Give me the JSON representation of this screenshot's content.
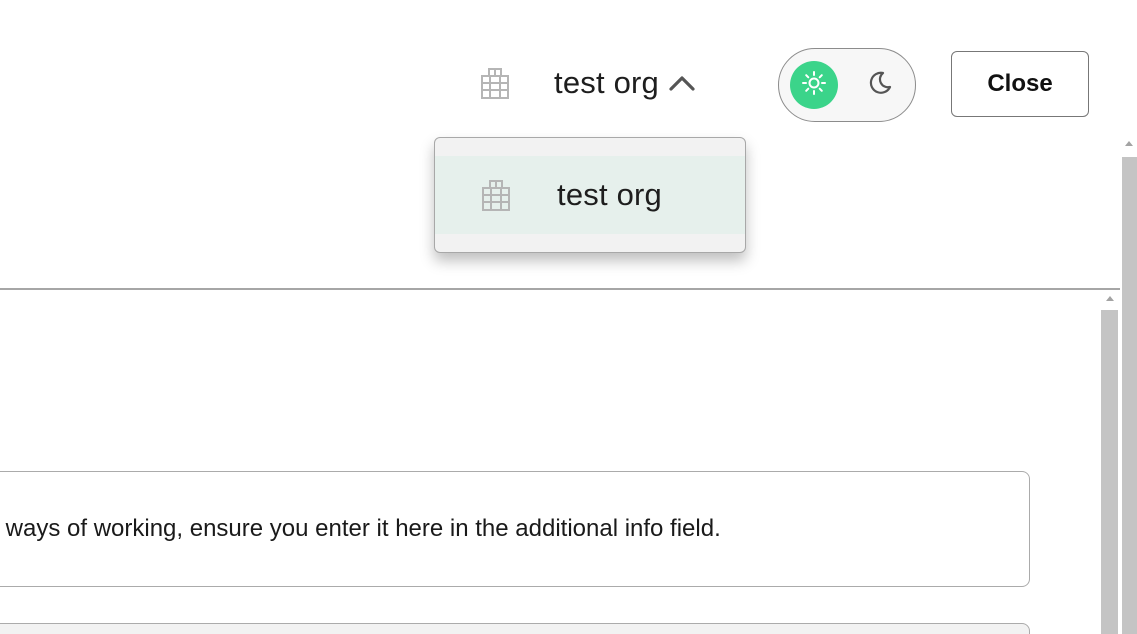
{
  "header": {
    "org_switcher": {
      "icon": "building-icon",
      "name": "test org",
      "chevron": "chevron-up-icon"
    },
    "theme_toggle": {
      "light_icon": "sun-icon",
      "dark_icon": "moon-icon",
      "selected": "light",
      "accent_color": "#3bd48a"
    },
    "close_label": "Close"
  },
  "dropdown": {
    "items": [
      {
        "icon": "building-icon",
        "label": "test org",
        "highlight_color": "#e6f0ec"
      }
    ]
  },
  "main": {
    "info_text": "c ways of working, ensure you enter it here in the additional info field."
  }
}
